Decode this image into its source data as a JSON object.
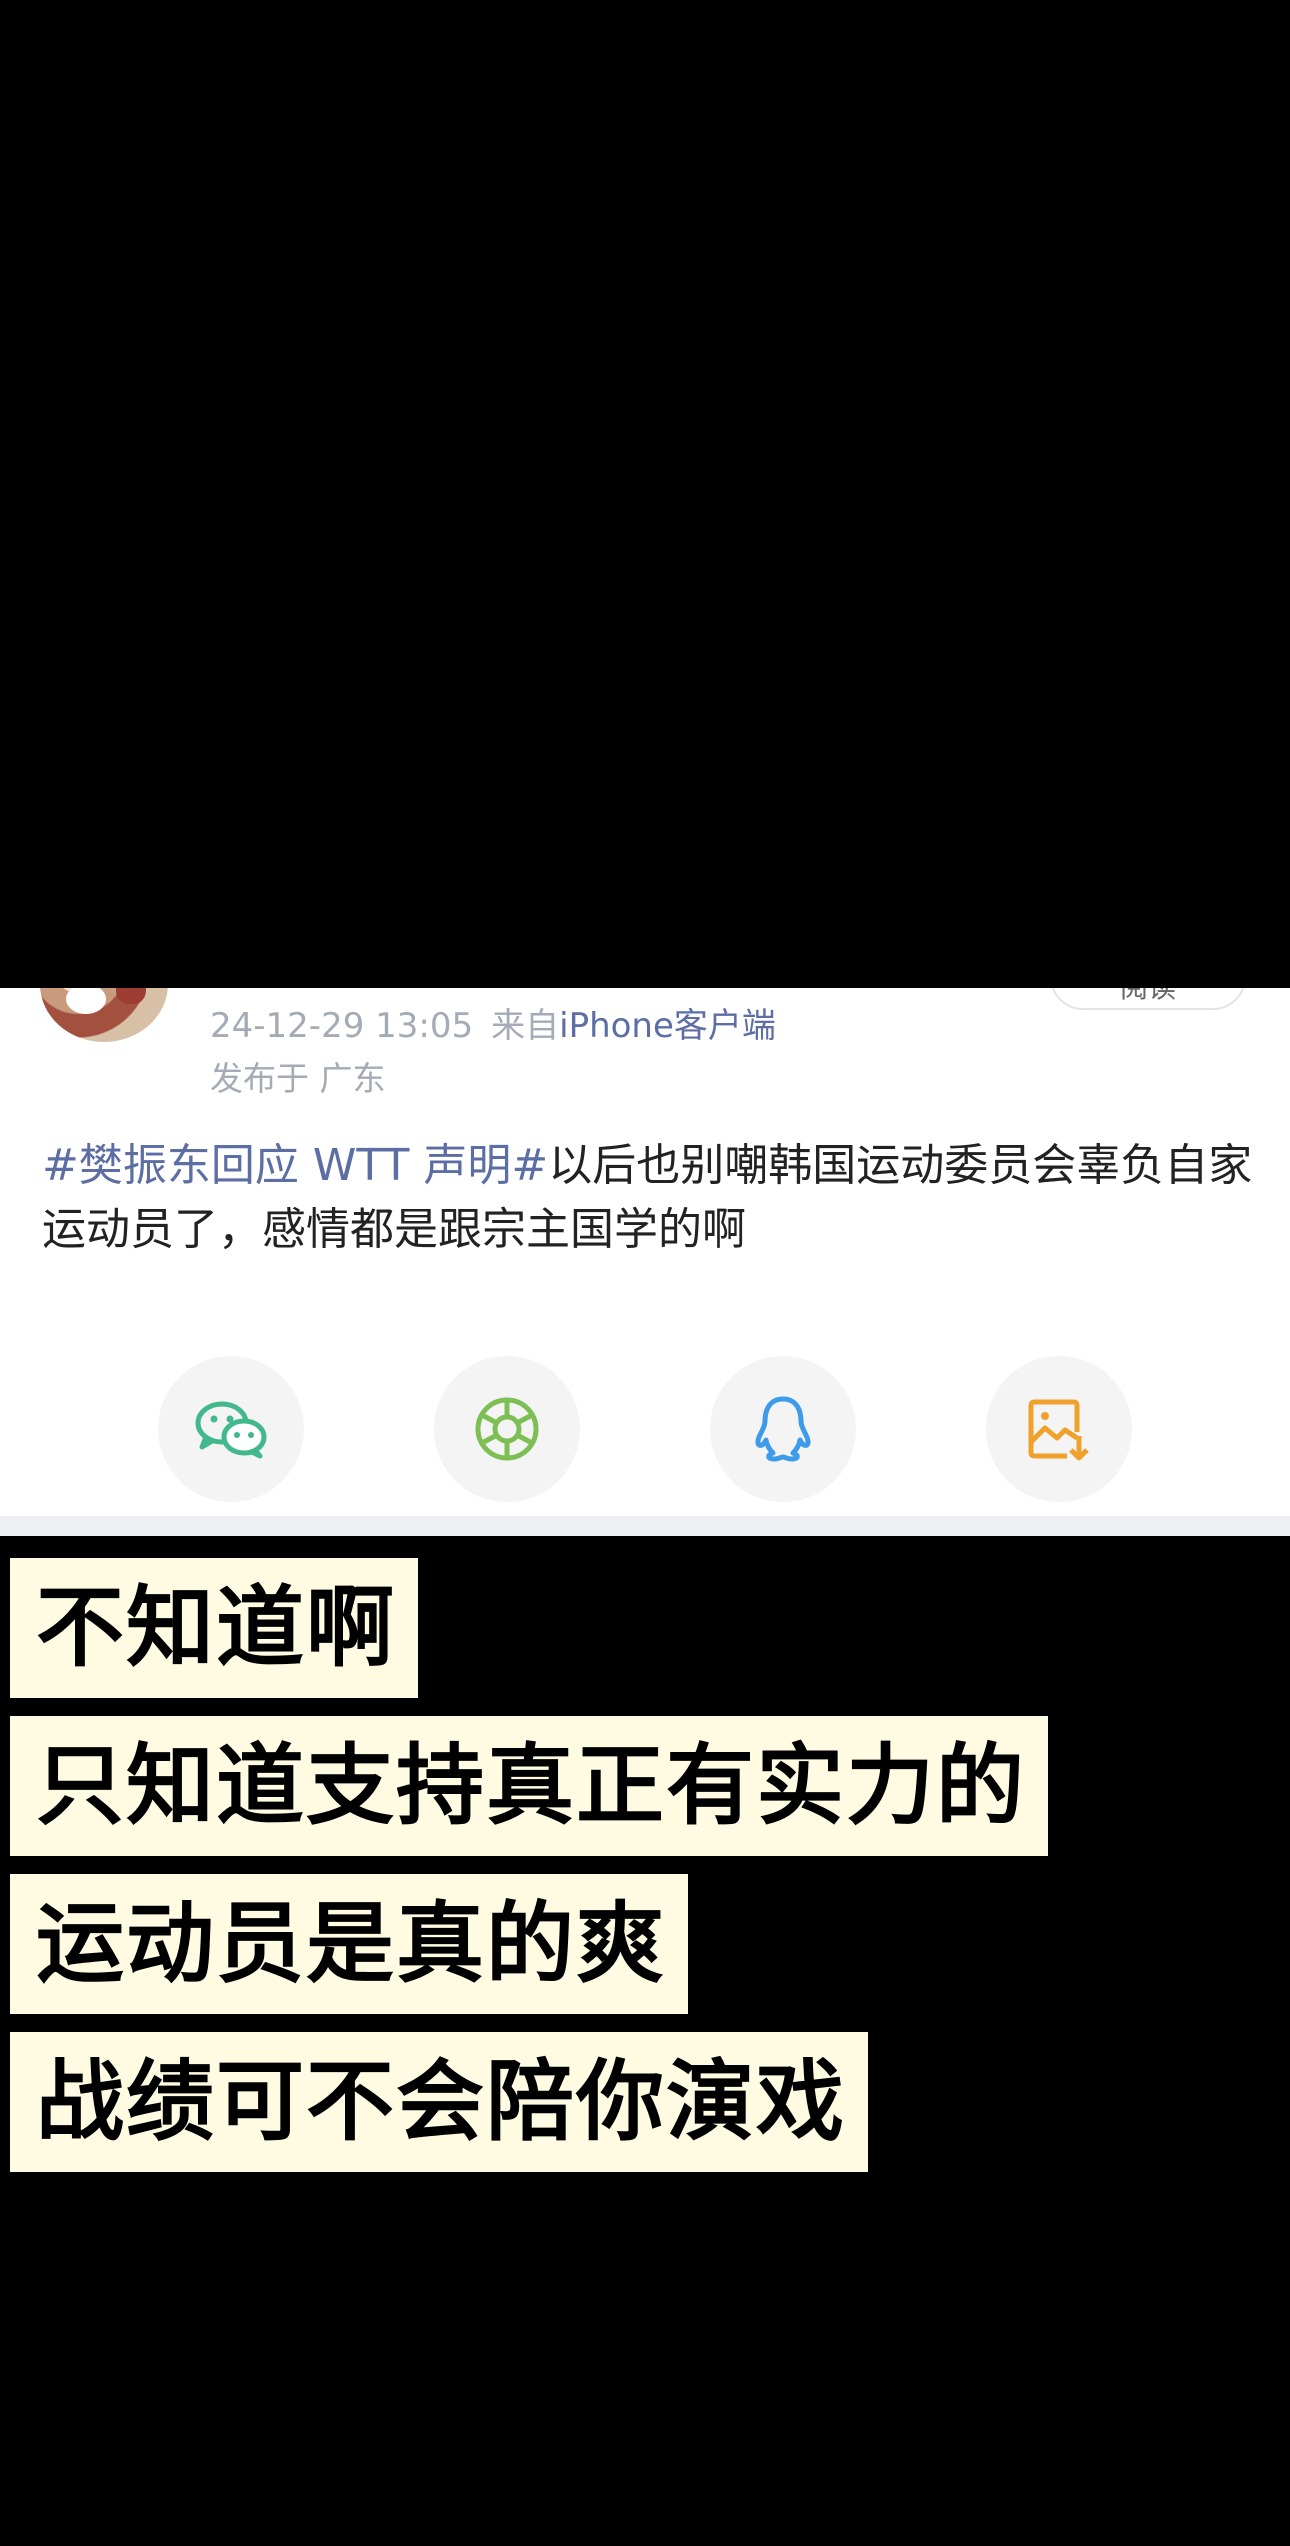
{
  "post": {
    "timestamp": "24-12-29 13:05",
    "source_prefix": "来自",
    "source_client": "iPhone客户端",
    "location": "发布于 广东",
    "read_button": "阅读",
    "topic": "#樊振东回应 WTT 声明#",
    "body": "以后也别嘲韩国运动委员会辜负自家运动员了，感情都是跟宗主国学的啊"
  },
  "share": {
    "items": [
      {
        "icon": "wechat-icon",
        "color": "#43b88d"
      },
      {
        "icon": "moments-icon",
        "color": "#7dbf55"
      },
      {
        "icon": "qq-icon",
        "color": "#3d9be9"
      },
      {
        "icon": "save-image-icon",
        "color": "#f0a12c"
      }
    ]
  },
  "captions": [
    "不知道啊",
    "只知道支持真正有实力的",
    "运动员是真的爽",
    "战绩可不会陪你演戏"
  ]
}
